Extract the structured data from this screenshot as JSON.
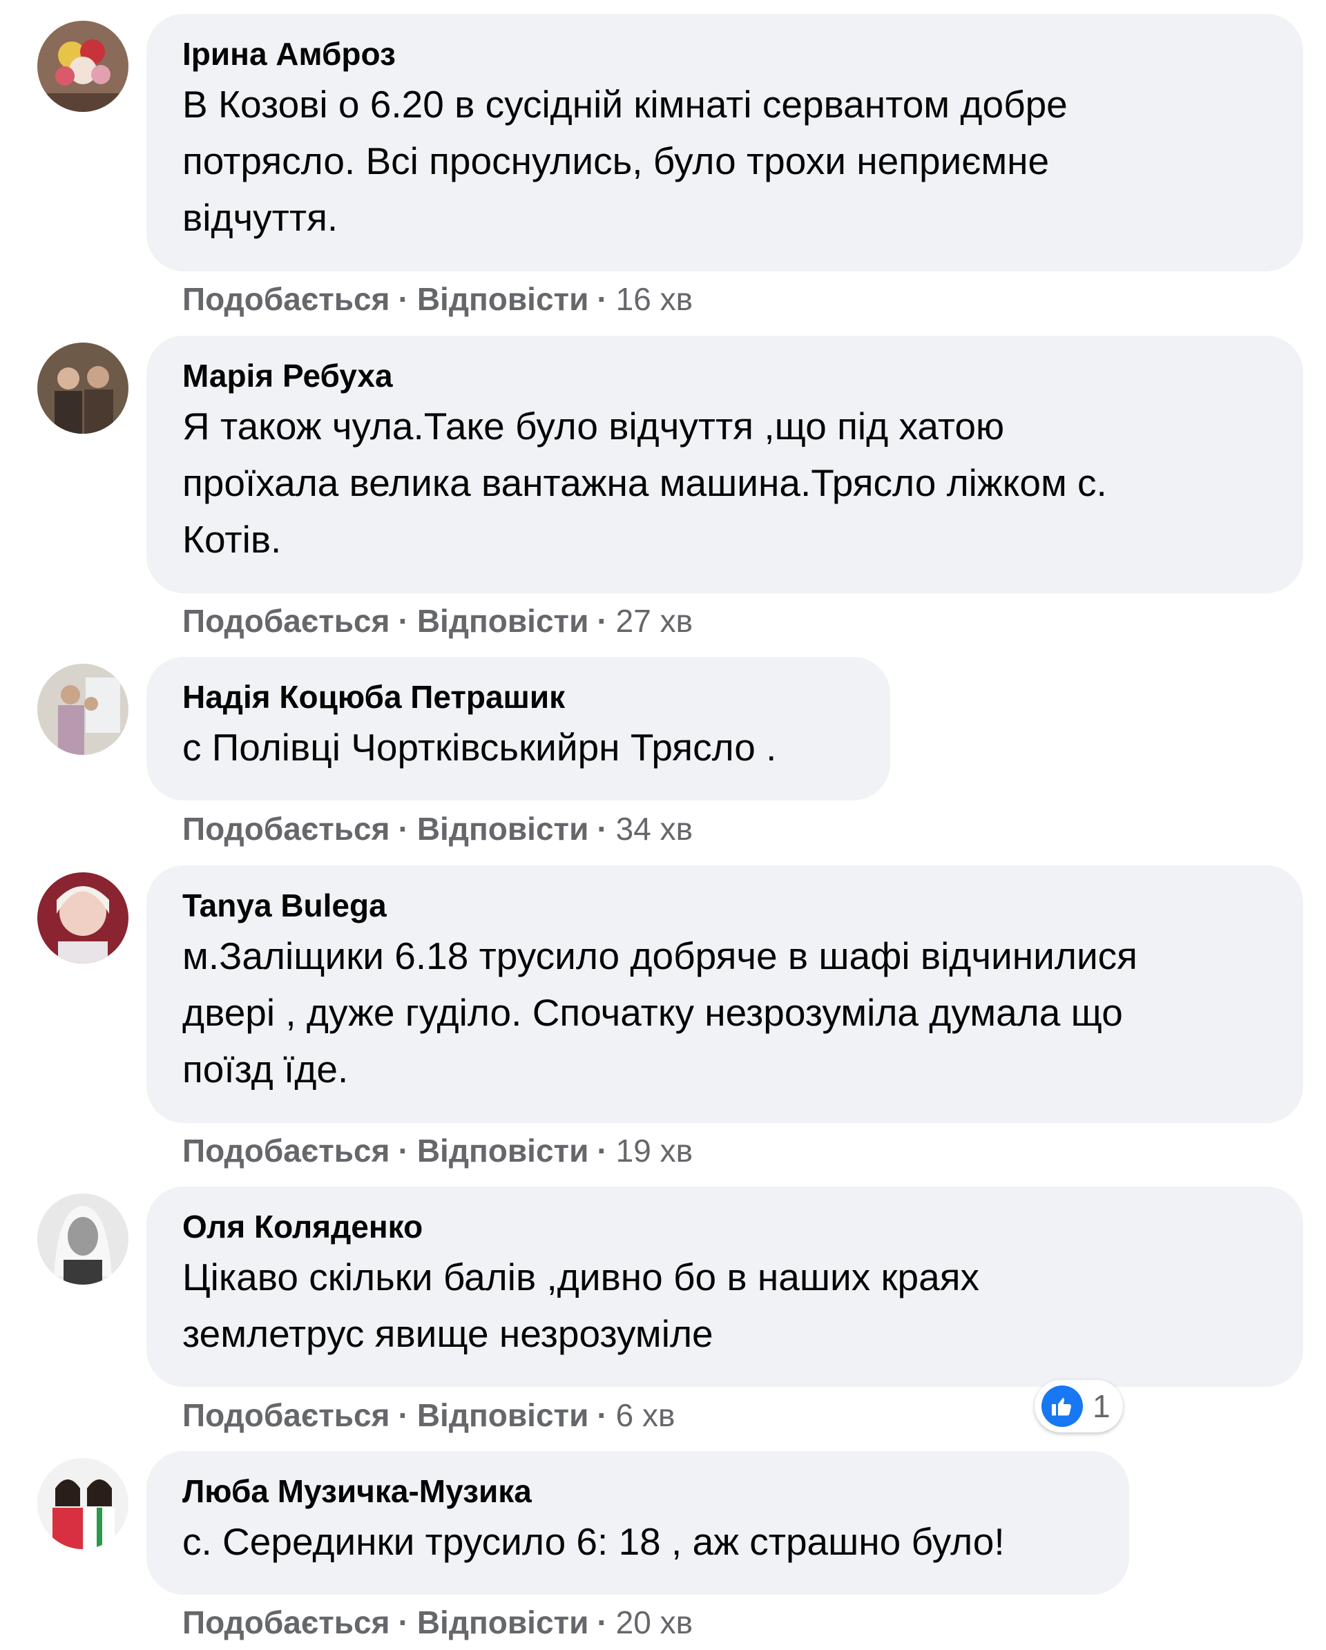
{
  "actions": {
    "like_label": "Подобається",
    "reply_label": "Відповісти",
    "separator": "·"
  },
  "comments": [
    {
      "author": "Ірина Амброз",
      "lines": [
        "В Козові о 6.20 в сусідній кімнаті сервантом добре",
        "потрясло. Всі проснулись, було трохи неприємне",
        "відчуття."
      ],
      "time": "16 хв"
    },
    {
      "author": "Марія Ребуха",
      "lines": [
        "Я також чула.Таке було відчуття ,що під хатою",
        "проїхала велика вантажна машина.Трясло ліжком с.",
        "Котів."
      ],
      "time": "27 хв"
    },
    {
      "author": "Надія Коцюба Петрашик",
      "lines": [
        "с Полівці Чортківськийрн Трясло ."
      ],
      "time": "34 хв"
    },
    {
      "author": "Tanya Bulega",
      "lines": [
        "м.Заліщики 6.18 трусило добряче в шафі відчинилися",
        "двері , дуже гуділо. Спочатку незрозуміла думала що",
        "поїзд їде."
      ],
      "time": "19 хв"
    },
    {
      "author": "Оля Коляденко",
      "lines": [
        "Цікаво скільки балів ,дивно бо в наших краях",
        "землетрус явище незрозуміле"
      ],
      "time": "6 хв"
    },
    {
      "author": "Люба Музичка-Музика",
      "lines": [
        "с. Серединки трусило 6: 18 , аж страшно було!"
      ],
      "time": "20 хв",
      "reaction": {
        "icon": "like-icon",
        "count": "1"
      }
    }
  ]
}
